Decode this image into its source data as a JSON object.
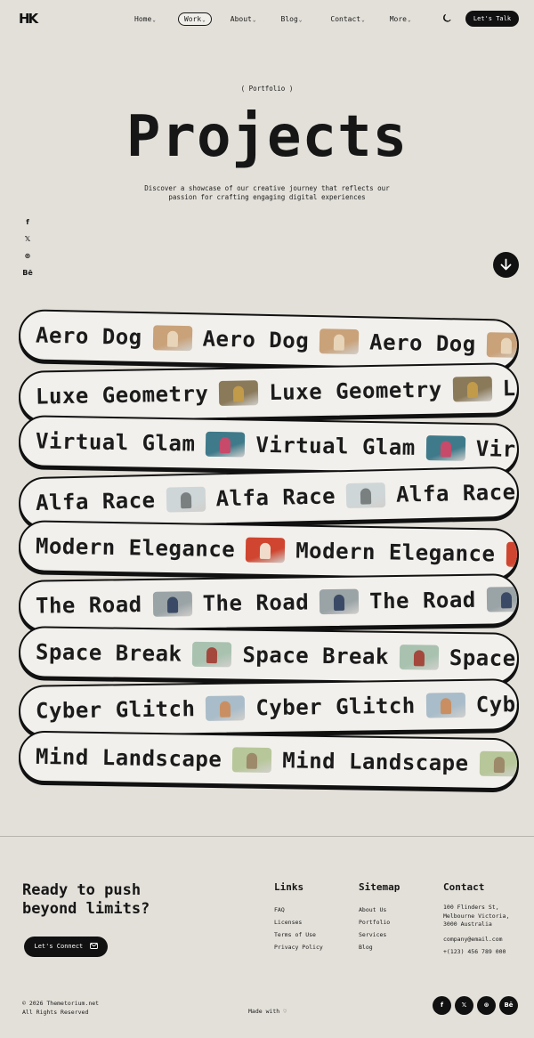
{
  "header": {
    "logo": "HK",
    "nav": [
      {
        "label": "Home"
      },
      {
        "label": "Work"
      },
      {
        "label": "About"
      },
      {
        "label": "Blog"
      },
      {
        "label": "Contact"
      },
      {
        "label": "More"
      }
    ],
    "chevron": "⌄",
    "cta": "Let's Talk"
  },
  "hero": {
    "eyebrow": "( Portfolio )",
    "title": "Projects",
    "subtitle": "Discover a showcase of our creative journey that reflects our passion for crafting engaging digital experiences"
  },
  "side_social": [
    "f",
    "𝕏",
    "⊛",
    "Bē"
  ],
  "projects": [
    {
      "name": "Aero Dog",
      "bg": "#c9a27a",
      "fg": "#e8d4b8"
    },
    {
      "name": "Luxe Geometry",
      "bg": "#8a7a5a",
      "fg": "#c19a4a"
    },
    {
      "name": "Virtual Glam",
      "bg": "#3f7a8a",
      "fg": "#c74a6a"
    },
    {
      "name": "Alfa Race",
      "bg": "#cfd6d8",
      "fg": "#7a7f80"
    },
    {
      "name": "Modern Elegance",
      "bg": "#d0452f",
      "fg": "#f1dccb"
    },
    {
      "name": "The Road",
      "bg": "#9aa3a6",
      "fg": "#3a4a66"
    },
    {
      "name": "Space Break",
      "bg": "#a9c2b0",
      "fg": "#a4483e"
    },
    {
      "name": "Cyber Glitch",
      "bg": "#a9bcc9",
      "fg": "#c98f62"
    },
    {
      "name": "Mind Landscape",
      "bg": "#b7c79a",
      "fg": "#9c8a6a"
    }
  ],
  "footer": {
    "headline": "Ready to push beyond limits?",
    "connect": "Let's Connect",
    "links": {
      "title": "Links",
      "items": [
        "FAQ",
        "Licenses",
        "Terms of Use",
        "Privacy Policy"
      ]
    },
    "sitemap": {
      "title": "Sitemap",
      "items": [
        "About Us",
        "Portfolio",
        "Services",
        "Blog"
      ]
    },
    "contact": {
      "title": "Contact",
      "address": "100 Flinders St, Melbourne Victoria, 3000 Australia",
      "email": "company@email.com",
      "phone": "+(123) 456 789 000"
    },
    "copyright_1": "© 2026 Themetorium.net",
    "copyright_2": "All Rights Reserved",
    "made_with": "Made with ♡",
    "social": [
      "f",
      "𝕏",
      "⊛",
      "Bē"
    ]
  }
}
